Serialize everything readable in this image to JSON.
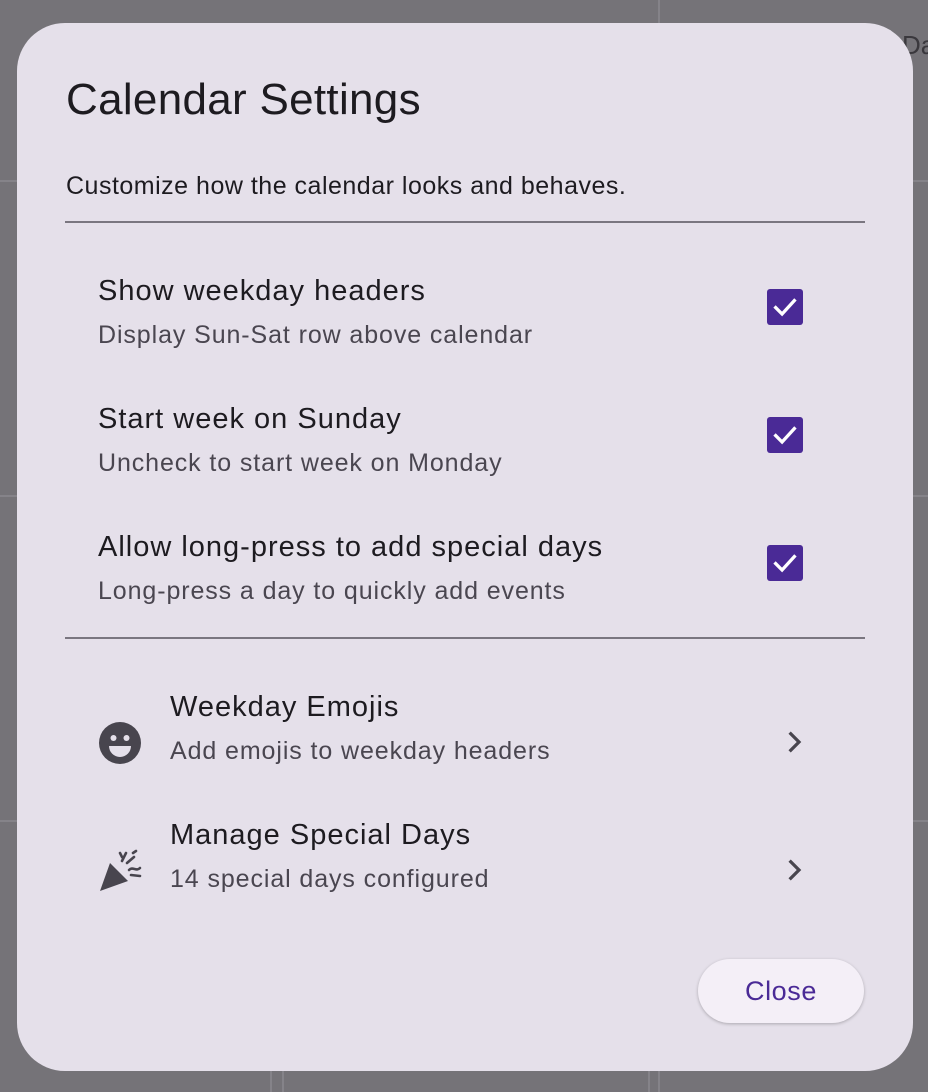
{
  "background": {
    "partial_text": "Da"
  },
  "dialog": {
    "title": "Calendar Settings",
    "subtitle": "Customize how the calendar looks and behaves.",
    "toggles": [
      {
        "title": "Show weekday headers",
        "subtitle": "Display Sun-Sat row above calendar",
        "checked": true
      },
      {
        "title": "Start week on Sunday",
        "subtitle": "Uncheck to start week on Monday",
        "checked": true
      },
      {
        "title": "Allow long-press to add special days",
        "subtitle": "Long-press a day to quickly add events",
        "checked": true
      }
    ],
    "nav_items": [
      {
        "icon": "smiley-face-icon",
        "title": "Weekday Emojis",
        "subtitle": "Add emojis to weekday headers"
      },
      {
        "icon": "party-popper-icon",
        "title": "Manage Special Days",
        "subtitle": "14 special days configured"
      }
    ],
    "close_label": "Close"
  },
  "colors": {
    "scrim": "#757378",
    "dialog_surface": "#e5e0ea",
    "accent": "#4a2a96",
    "text_primary": "#1d1b20",
    "text_secondary": "#4a4650",
    "divider": "#7a7680"
  }
}
